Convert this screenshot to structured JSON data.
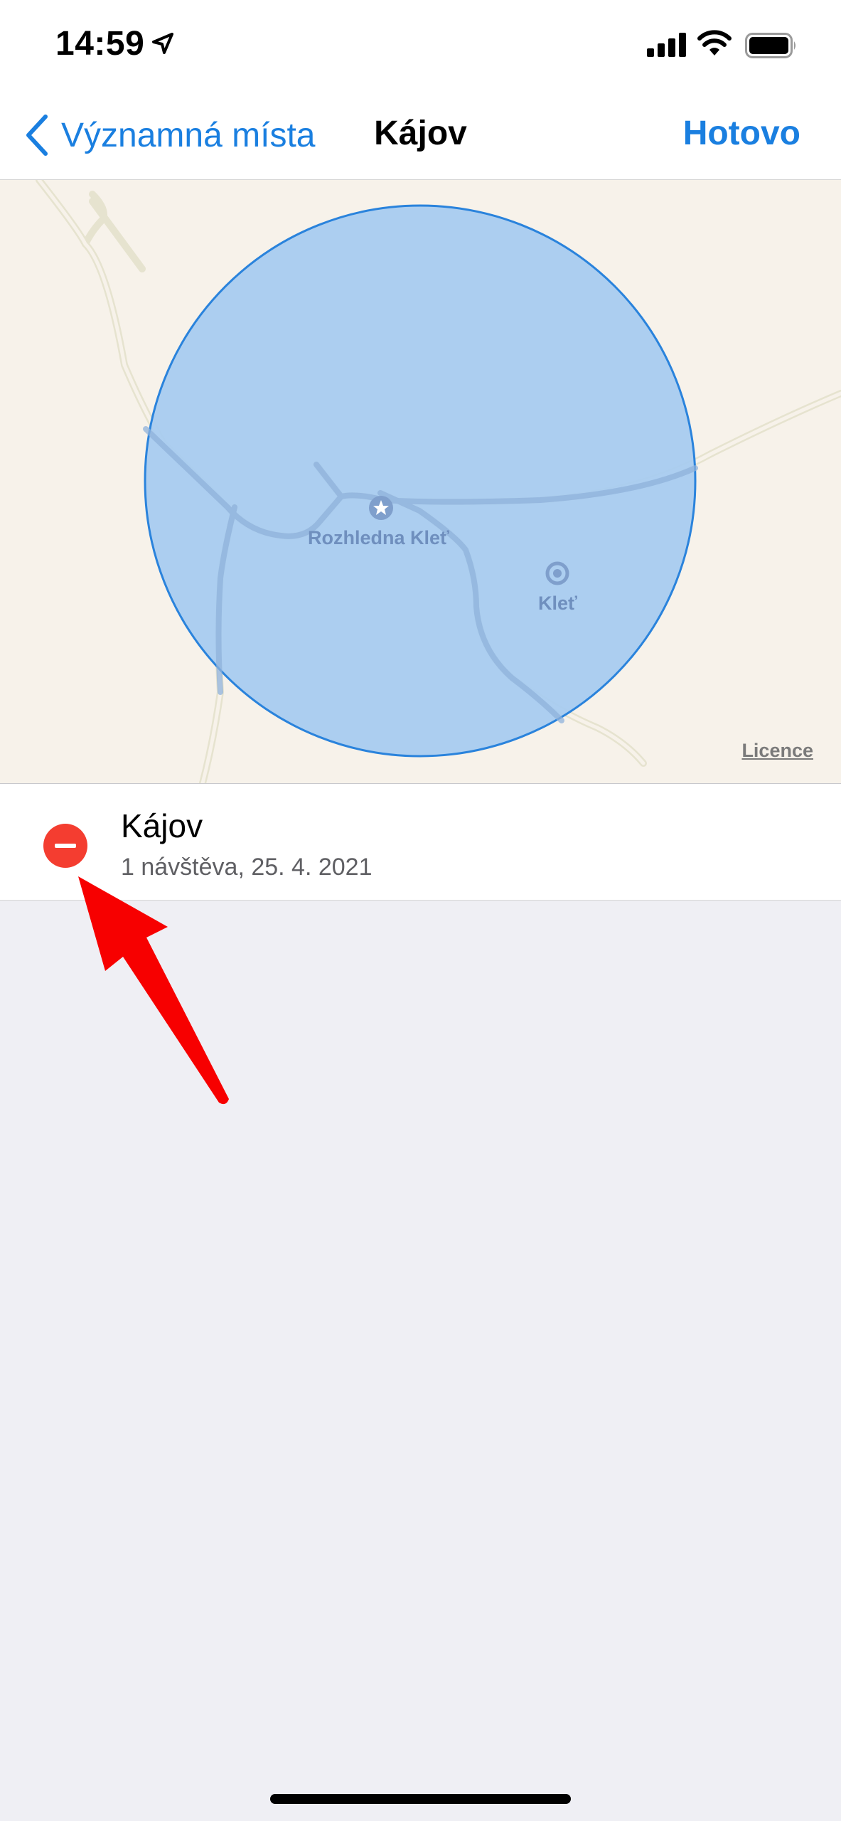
{
  "status_bar": {
    "time": "14:59",
    "icons": [
      "location-arrow-icon",
      "cellular-signal-icon",
      "wifi-icon",
      "battery-icon"
    ]
  },
  "nav": {
    "back_label": "Významná místa",
    "title": "Kájov",
    "done_label": "Hotovo"
  },
  "map": {
    "labels": {
      "poi1": "Rozhledna Kleť",
      "poi2": "Kleť"
    },
    "licence": "Licence",
    "region_fill": "#a6cbf0",
    "region_stroke": "#2a83dc"
  },
  "place": {
    "name": "Kájov",
    "subtitle": "1 návštěva, 25. 4. 2021"
  },
  "colors": {
    "accent": "#1a7fe0",
    "delete": "#f43d30",
    "annotation_arrow": "#f70000"
  }
}
